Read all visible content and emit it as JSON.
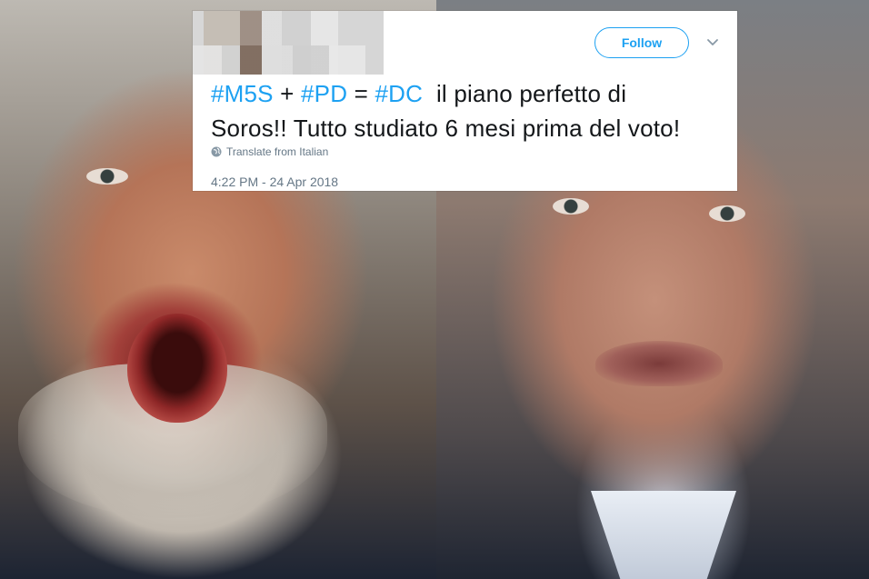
{
  "tweet": {
    "follow_label": "Follow",
    "hashtags": [
      "#M5S",
      "#PD",
      "#DC"
    ],
    "plus": "+",
    "equals": "=",
    "text_line1_tail": "il piano perfetto di",
    "text_line2": "Soros!! Tutto studiato 6 mesi prima del voto!",
    "translate_label": "Translate from Italian",
    "timestamp": "4:22 PM - 24 Apr 2018"
  },
  "colors": {
    "link": "#1da1f2",
    "text": "#14171a",
    "muted": "#657786"
  },
  "icons": {
    "menu": "chevron-down-icon",
    "translate": "globe-icon"
  }
}
